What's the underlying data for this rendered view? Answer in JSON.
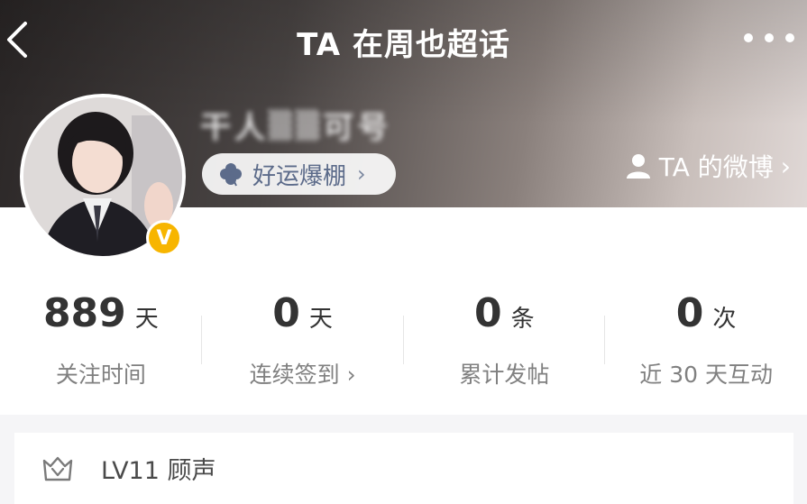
{
  "header": {
    "title": "TA 在周也超话",
    "username": "干人▒▒可号",
    "badge_label": "好运爆棚",
    "badge_chevron": "›",
    "weibo_link": "TA 的微博",
    "weibo_chevron": "›"
  },
  "avatar": {
    "verified_mark": "V"
  },
  "stats": [
    {
      "value": "889",
      "unit": "天",
      "label": "关注时间"
    },
    {
      "value": "0",
      "unit": "天",
      "label": "连续签到 ›"
    },
    {
      "value": "0",
      "unit": "条",
      "label": "累计发帖"
    },
    {
      "value": "0",
      "unit": "次",
      "label": "近 30 天互动"
    }
  ],
  "level": {
    "text": "LV11 顾声"
  },
  "colors": {
    "verify": "#f7b500",
    "badge_text": "#5c6b8a",
    "stat_label": "#808080"
  },
  "icons": [
    "back-chevron-icon",
    "more-icon",
    "clover-icon",
    "person-icon",
    "verified-v-icon",
    "level-crown-icon"
  ]
}
